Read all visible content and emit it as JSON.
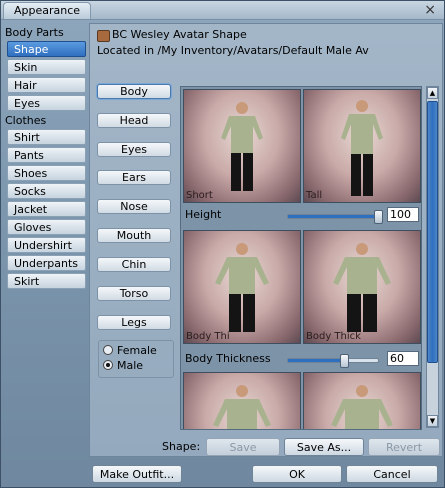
{
  "window": {
    "title": "Appearance",
    "close_glyph": "×"
  },
  "left_panel": {
    "body_parts_label": "Body Parts",
    "body_parts": [
      "Shape",
      "Skin",
      "Hair",
      "Eyes"
    ],
    "clothes_label": "Clothes",
    "clothes": [
      "Shirt",
      "Pants",
      "Shoes",
      "Socks",
      "Jacket",
      "Gloves",
      "Undershirt",
      "Underpants",
      "Skirt"
    ],
    "selected": "Shape"
  },
  "header": {
    "title": "BC Wesley Avatar Shape",
    "path": "Located in /My Inventory/Avatars/Default Male Av"
  },
  "subparts": {
    "items": [
      "Body",
      "Head",
      "Eyes",
      "Ears",
      "Nose",
      "Mouth",
      "Chin",
      "Torso",
      "Legs"
    ],
    "selected": "Body"
  },
  "sex": {
    "female": "Female",
    "male": "Male",
    "selected": "Male"
  },
  "params": [
    {
      "name": "Height",
      "low_label": "Short",
      "high_label": "Tall",
      "value": "100",
      "fraction": 1.0
    },
    {
      "name": "Body Thickness",
      "low_label": "Body Thi",
      "high_label": "Body Thick",
      "value": "60",
      "fraction": 0.6
    }
  ],
  "bottom": {
    "shape_label": "Shape:",
    "save": "Save",
    "save_as": "Save As...",
    "revert": "Revert",
    "make_outfit": "Make Outfit...",
    "ok": "OK",
    "cancel": "Cancel"
  },
  "colors": {
    "accent": "#2f6fbf",
    "window_bg": "#7d97ae",
    "thumb_bg": "#c9aaa8"
  },
  "icons": {
    "close": "close-icon",
    "inventory_item": "shape-item-icon",
    "scroll_up": "arrow-up-icon",
    "scroll_down": "arrow-down-icon"
  }
}
